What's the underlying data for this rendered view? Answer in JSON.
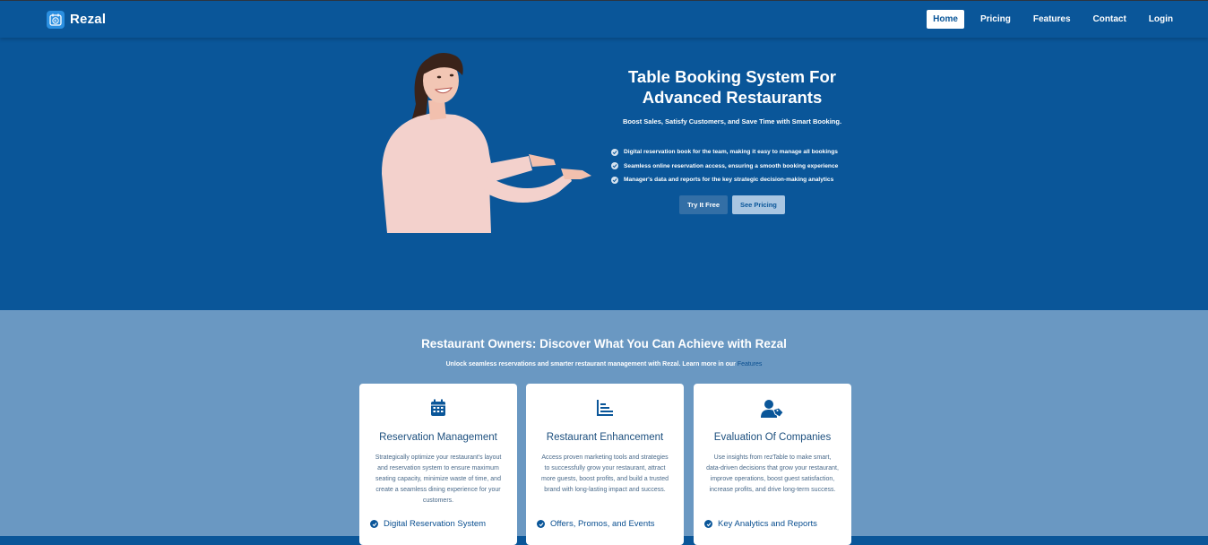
{
  "brand": {
    "name": "Rezal",
    "logo_icon": "calendar-logo-icon"
  },
  "nav": {
    "items": [
      {
        "label": "Home",
        "active": true
      },
      {
        "label": "Pricing",
        "active": false
      },
      {
        "label": "Features",
        "active": false
      },
      {
        "label": "Contact",
        "active": false
      },
      {
        "label": "Login",
        "active": false
      }
    ]
  },
  "hero": {
    "title": "Table Booking System For Advanced Restaurants",
    "subtitle": "Boost Sales, Satisfy Customers, and Save Time with Smart Booking.",
    "bullets": [
      "Digital reservation book for the team, making it easy to manage all bookings",
      "Seamless online reservation access, ensuring a smooth booking experience",
      "Manager's data and reports for the key strategic decision-making analytics"
    ],
    "primary_button": "Try It Free",
    "secondary_button": "See Pricing"
  },
  "features": {
    "title": "Restaurant Owners: Discover What You Can Achieve with Rezal",
    "subtitle": "Unlock seamless reservations and smarter restaurant management with Rezal. Learn more in our",
    "subtitle_link": "Features",
    "cards": [
      {
        "icon": "calendar-icon",
        "title": "Reservation Management",
        "description": "Strategically optimize your restaurant's layout and reservation system to ensure maximum seating capacity, minimize waste of time, and create a seamless dining experience for your customers.",
        "feature": "Digital Reservation System"
      },
      {
        "icon": "chart-icon",
        "title": "Restaurant Enhancement",
        "description": "Access proven marketing tools and strategies to successfully grow your restaurant, attract more guests, boost profits, and build a trusted brand with long-lasting impact and success.",
        "feature": "Offers, Promos, and Events"
      },
      {
        "icon": "user-tag-icon",
        "title": "Evaluation Of Companies",
        "description": "Use insights from rezTable to make smart, data-driven decisions that grow your restaurant, improve operations, boost guest satisfaction, increase profits, and drive long-term success.",
        "feature": "Key Analytics and Reports"
      }
    ]
  },
  "colors": {
    "primary": "#0a5699",
    "section_bg": "#6a98c2",
    "card_title": "#1c4f7e"
  }
}
